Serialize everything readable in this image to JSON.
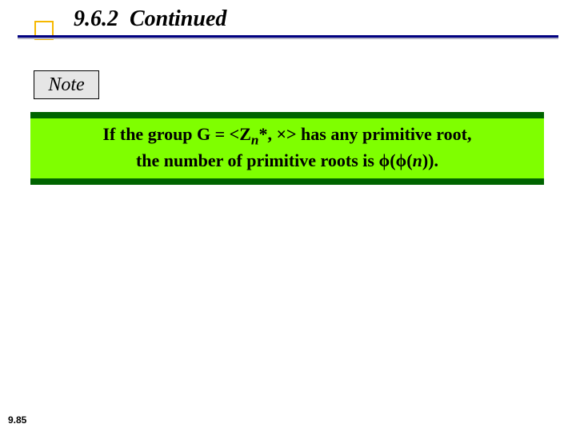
{
  "header": {
    "section_number": "9.6.2",
    "section_title": "Continued"
  },
  "note": {
    "label": "Note"
  },
  "callout": {
    "line1_pre": "If the group G = <Z",
    "line1_sub": "n",
    "line1_post": "*, ×> has any primitive root,",
    "line2_pre": "the number of primitive roots is ",
    "line2_phi1": "ϕ",
    "line2_paren1": "(",
    "line2_phi2": "ϕ",
    "line2_paren2": "(",
    "line2_n": "n",
    "line2_close": ")).",
    "full_text": "If the group G = <Zn*, ×> has any primitive root, the number of primitive roots is ϕ(ϕ(n))."
  },
  "page": {
    "number": "9.85"
  }
}
